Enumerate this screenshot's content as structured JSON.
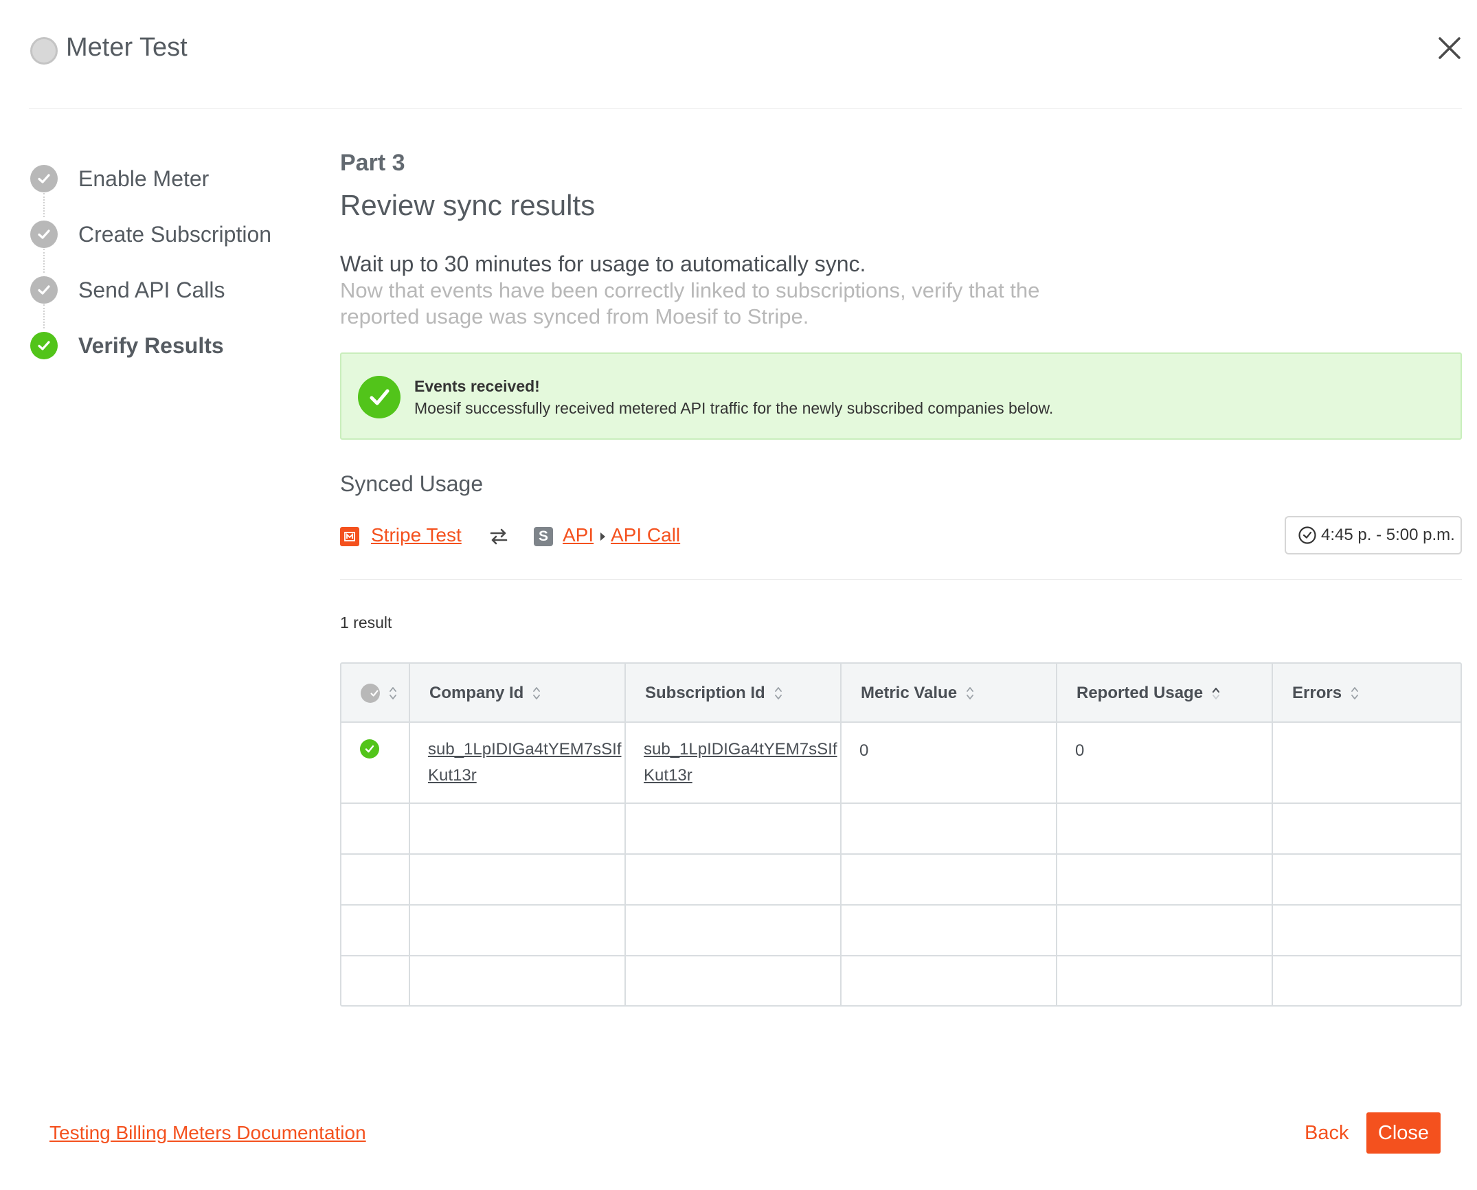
{
  "header": {
    "title": "Meter Test"
  },
  "steps": [
    {
      "label": "Enable Meter",
      "status": "done"
    },
    {
      "label": "Create Subscription",
      "status": "done"
    },
    {
      "label": "Send API Calls",
      "status": "done"
    },
    {
      "label": "Verify Results",
      "status": "active"
    }
  ],
  "main": {
    "part": "Part 3",
    "title": "Review sync results",
    "wait": "Wait up to 30 minutes for usage to automatically sync.",
    "description": "Now that events have been correctly linked to subscriptions, verify that the reported usage was synced from Moesif to Stripe."
  },
  "alert": {
    "title": "Events received!",
    "message": "Moesif successfully received metered API traffic for the newly subscribed companies below."
  },
  "synced": {
    "label": "Synced Usage",
    "source": "Stripe Test",
    "target_parent": "API",
    "target": "API Call",
    "s_badge": "S",
    "time_range": "4:45 p. - 5:00 p.m."
  },
  "results": {
    "count": "1 result"
  },
  "table": {
    "columns": [
      "Company Id",
      "Subscription Id",
      "Metric Value",
      "Reported Usage",
      "Errors"
    ],
    "rows": [
      {
        "company_id": "sub_1LpIDIGa4tYEM7sSIfKut13r",
        "subscription_id": "sub_1LpIDIGa4tYEM7sSIfKut13r",
        "metric_value": "0",
        "reported_usage": "0",
        "errors": ""
      }
    ]
  },
  "footer": {
    "doc_link": "Testing Billing Meters Documentation",
    "back": "Back",
    "close": "Close"
  },
  "colors": {
    "accent": "#f4511e",
    "success": "#52c41a",
    "alert_bg": "#e4f9dc"
  }
}
